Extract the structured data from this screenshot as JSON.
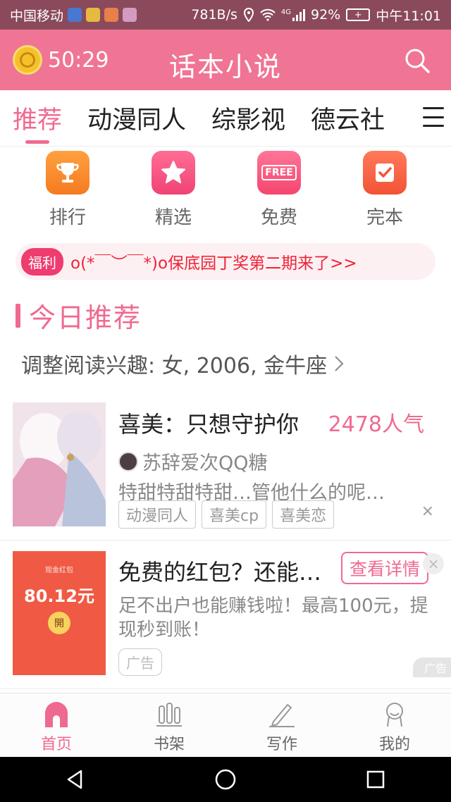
{
  "status_bar": {
    "carrier": "中国移动",
    "speed": "781B/s",
    "signal": "4G",
    "battery": "92%",
    "time": "中午11:01"
  },
  "app_bar": {
    "timer": "50:29",
    "title": "话本小说",
    "icons": {
      "timer": "coin-clock-icon",
      "search": "search-icon"
    }
  },
  "tabs": {
    "items": [
      {
        "label": "推荐",
        "active": true
      },
      {
        "label": "动漫同人"
      },
      {
        "label": "综影视"
      },
      {
        "label": "德云社"
      }
    ]
  },
  "quick_entries": [
    {
      "label": "排行",
      "icon": "trophy-icon",
      "color": "#f7892b"
    },
    {
      "label": "精选",
      "icon": "star-icon",
      "color": "#f24f7f"
    },
    {
      "label": "免费",
      "icon": "free-icon",
      "color": "#f2557a",
      "icon_text": "FREE"
    },
    {
      "label": "完本",
      "icon": "check-icon",
      "color": "#f35e3d"
    }
  ],
  "notice": {
    "badge": "福利",
    "text": "o(*￣︶￣*)o保底园丁奖第二期来了>>"
  },
  "section": {
    "title": "今日推荐",
    "interest": "调整阅读兴趣: 女, 2006, 金牛座"
  },
  "book": {
    "title": "喜美：只想守护你",
    "popularity": "2478人气",
    "author": "苏辞爱次QQ糖",
    "description": "特甜特甜特甜…管他什么的呢…",
    "tags": [
      "动漫同人",
      "喜美cp",
      "喜美恋"
    ],
    "close": "×"
  },
  "ad": {
    "cover_header": "现金红包",
    "cover_amount": "80.12元",
    "cover_open": "開",
    "title": "免费的红包？还能…",
    "detail_button": "查看详情",
    "close": "×",
    "description": "足不出户也能赚钱啦！最高100元，提现秒到账！",
    "tag": "广告",
    "mark": "广告"
  },
  "bottom_nav": [
    {
      "label": "首页",
      "icon": "home-icon",
      "active": true
    },
    {
      "label": "书架",
      "icon": "bookshelf-icon"
    },
    {
      "label": "写作",
      "icon": "pen-icon"
    },
    {
      "label": "我的",
      "icon": "profile-icon"
    }
  ],
  "colors": {
    "brand": "#f07493",
    "accent": "#ef6a8f",
    "notice_text": "#ee2438"
  }
}
